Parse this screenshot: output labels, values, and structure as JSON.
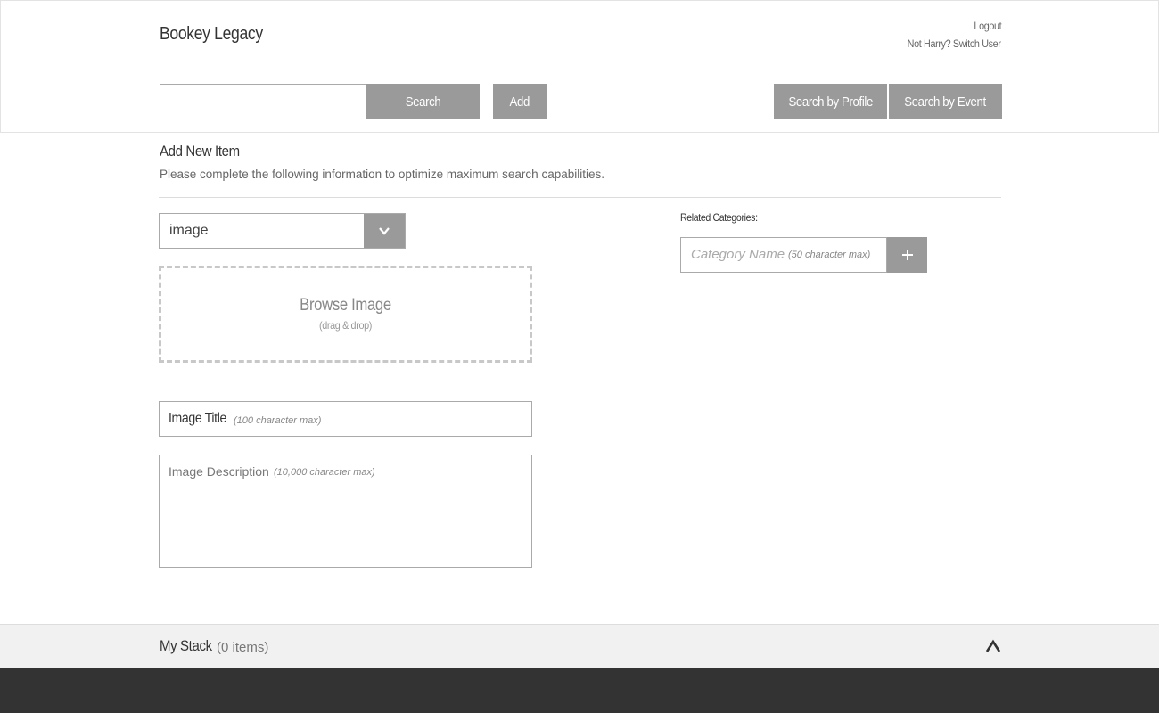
{
  "header": {
    "brand": "Bookey Legacy",
    "logout": "Logout",
    "switch_user": "Not Harry? Switch User"
  },
  "searchbar": {
    "search_value": "",
    "search_label": "Search",
    "add_label": "Add",
    "search_profile_label": "Search by Profile",
    "search_event_label": "Search by Event"
  },
  "form": {
    "title": "Add New Item",
    "subtitle": "Please complete the following information to optimize maximum search capabilities.",
    "type_select": {
      "selected": "image",
      "arrow_icon": "chevron-down-icon"
    },
    "dropzone": {
      "title": "Browse Image",
      "hint": "(drag & drop)"
    },
    "title_field": {
      "label": "Image Title",
      "hint": "(100 character max)"
    },
    "description_field": {
      "label": "Image Description",
      "hint": "(10,000 character max)"
    },
    "related": {
      "label": "Related Categories:",
      "placeholder": "Category Name",
      "hint": "(50 character max)",
      "add_icon": "plus-icon"
    }
  },
  "stack": {
    "title": "My Stack",
    "count": "(0 items)",
    "toggle_icon": "chevron-up-icon"
  },
  "colors": {
    "button_gray": "#9a9a9a",
    "footer": "#333333",
    "stack_bar": "#f1f1f1"
  }
}
